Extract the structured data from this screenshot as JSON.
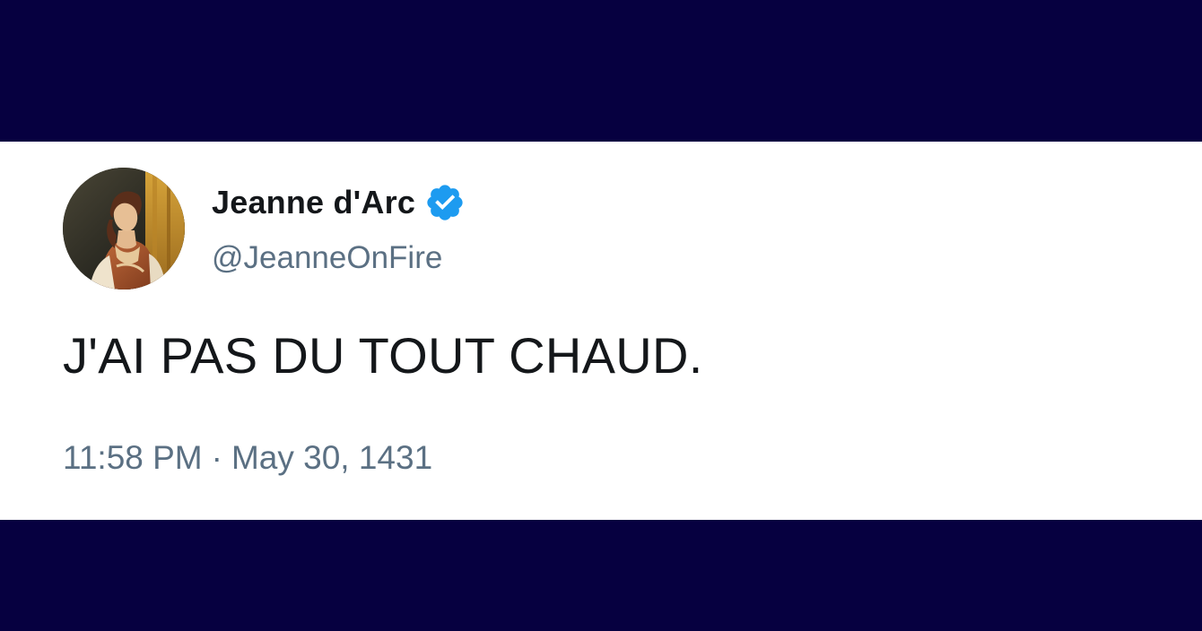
{
  "colors": {
    "background": "#060040",
    "card": "#ffffff",
    "name_text": "#14171a",
    "secondary_text": "#5b7083",
    "verified_badge": "#1d9bf0"
  },
  "tweet": {
    "author": {
      "display_name": "Jeanne d'Arc",
      "handle": "@JeanneOnFire",
      "verified": true,
      "avatar_icon": "portrait-painting-avatar",
      "verified_icon": "verified-badge-icon"
    },
    "text": "J'AI PAS DU TOUT CHAUD.",
    "time": "11:58 PM",
    "separator": "·",
    "date": "May 30, 1431"
  }
}
